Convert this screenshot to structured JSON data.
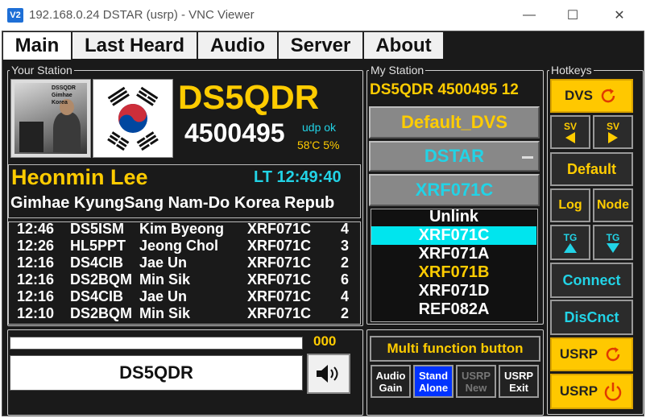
{
  "window": {
    "title": "192.168.0.24 DSTAR (usrp) - VNC Viewer",
    "icon": "vnc-icon"
  },
  "tabs": [
    {
      "label": "Main"
    },
    {
      "label": "Last Heard"
    },
    {
      "label": "Audio"
    },
    {
      "label": "Server"
    },
    {
      "label": "About"
    }
  ],
  "your_station": {
    "legend": "Your Station",
    "callsign": "DS5QDR",
    "id": "4500495",
    "udp_status": "udp ok",
    "temp_cpu": "58'C 5%",
    "photo_caption": "DSSQDR Gimhae Korea",
    "name": "Heonmin Lee",
    "time": "LT 12:49:40",
    "location": "Gimhae KyungSang Nam-Do Korea Repub"
  },
  "last_heard": [
    {
      "time": "12:46",
      "call": "DS5ISM",
      "name": "Kim Byeong",
      "tg": "XRF071C",
      "count": "4"
    },
    {
      "time": "12:26",
      "call": "HL5PPT",
      "name": "Jeong Chol",
      "tg": "XRF071C",
      "count": "3"
    },
    {
      "time": "12:16",
      "call": "DS4CIB",
      "name": "Jae Un",
      "tg": "XRF071C",
      "count": "2"
    },
    {
      "time": "12:16",
      "call": "DS2BQM",
      "name": "Min Sik",
      "tg": "XRF071C",
      "count": "6"
    },
    {
      "time": "12:16",
      "call": "DS4CIB",
      "name": "Jae Un",
      "tg": "XRF071C",
      "count": "4"
    },
    {
      "time": "12:10",
      "call": "DS2BQM",
      "name": "Min Sik",
      "tg": "XRF071C",
      "count": "2"
    }
  ],
  "bottom": {
    "counter": "000",
    "callsign": "DS5QDR",
    "progress": 0
  },
  "my_station": {
    "legend": "My Station",
    "header": "DS5QDR 4500495 12",
    "profile": "Default_DVS",
    "mode": "DSTAR",
    "reflector": "XRF071C",
    "reflectors": [
      {
        "label": "Unlink",
        "state": "normal"
      },
      {
        "label": "XRF071C",
        "state": "selected"
      },
      {
        "label": "XRF071A",
        "state": "normal"
      },
      {
        "label": "XRF071B",
        "state": "highlight"
      },
      {
        "label": "XRF071D",
        "state": "normal"
      },
      {
        "label": "REF082A",
        "state": "normal"
      }
    ]
  },
  "multi": {
    "title": "Multi function button",
    "buttons": [
      {
        "line1": "Audio",
        "line2": "Gain"
      },
      {
        "line1": "Stand",
        "line2": "Alone"
      },
      {
        "line1": "USRP",
        "line2": "New"
      },
      {
        "line1": "USRP",
        "line2": "Exit"
      }
    ]
  },
  "hotkeys": {
    "legend": "Hotkeys",
    "dvs": "DVS",
    "sv": "SV",
    "default": "Default",
    "log": "Log",
    "node": "Node",
    "tg": "TG",
    "connect": "Connect",
    "discnct": "DisCnct",
    "usrp": "USRP"
  },
  "colors": {
    "accent_yellow": "#ffcc00",
    "accent_cyan": "#22d3e6",
    "background": "#1a1a1a",
    "selected_row": "#00e5ee",
    "stand_alone": "#0033ff"
  }
}
